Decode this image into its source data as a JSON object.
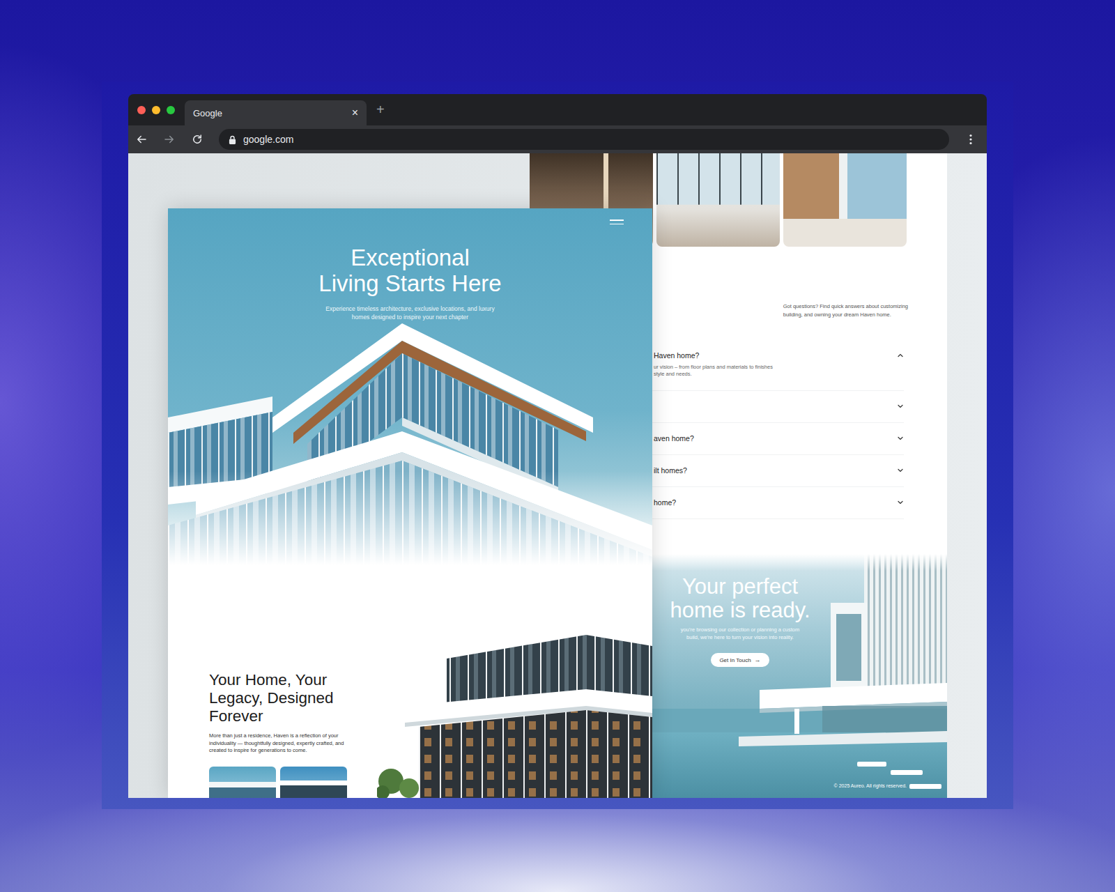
{
  "tabs": [
    {
      "label": "Google",
      "selected": true,
      "close": "×"
    }
  ],
  "tab_bar": {
    "new_tab": "+"
  },
  "address_bar": {
    "url": "google.com"
  },
  "hero": {
    "title_lines": [
      "Exceptional",
      "Living Starts Here"
    ],
    "subtitle_lines": [
      "Experience timeless architecture, exclusive locations, and luxury",
      "homes designed to inspire your next chapter"
    ]
  },
  "about": {
    "title_lines": [
      "Your Home, Your",
      "Legacy, Designed",
      "Forever"
    ],
    "body_lines": [
      "More than just a residence, Haven is a reflection of your",
      "individuality — thoughtfully designed, expertly crafted, and",
      "created to inspire for generations to come."
    ]
  },
  "faq": {
    "intro_lines": [
      "Got questions? Find quick answers about customizing",
      "building, and owning your dream Haven home."
    ],
    "items": [
      {
        "question": "Haven home?",
        "expanded": true,
        "answer_lines": [
          "ur vision – from floor plans and materials to finishes",
          "style and needs."
        ]
      },
      {
        "question": "",
        "expanded": false,
        "answer_lines": []
      },
      {
        "question": "aven home?",
        "expanded": false,
        "answer_lines": []
      },
      {
        "question": "ilt homes?",
        "expanded": false,
        "answer_lines": []
      },
      {
        "question": "home?",
        "expanded": false,
        "answer_lines": []
      }
    ]
  },
  "cta": {
    "title_lines": [
      "Your perfect",
      "home is ready."
    ],
    "body_lines": [
      "you're browsing our collection or planning a custom",
      "build, we're here to turn your vision into reality."
    ],
    "button": "Get In Touch",
    "button_icon": "→"
  },
  "footer": {
    "copyright": "© 2025 Aureo. All rights reserved."
  }
}
